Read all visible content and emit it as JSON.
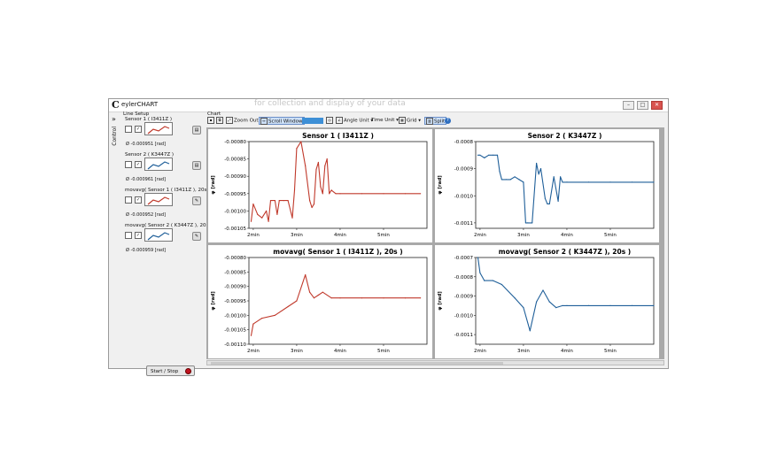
{
  "window": {
    "app_logo": "C",
    "app_title": "eylerCHART",
    "faded_tagline": "for collection and display of your data",
    "minimize": "–",
    "maximize": "□",
    "close": "✕"
  },
  "sidebar": {
    "collapse": "»",
    "tab_label": "Control",
    "line_setup_label": "Line Setup",
    "lines": [
      {
        "name": "Sensor 1 ( I3411Z )",
        "value": "Ø -0.000951 [rad]",
        "color": "#c0392b"
      },
      {
        "name": "Sensor 2 ( K3447Z )",
        "value": "Ø -0.000961 [rad]",
        "color": "#1f5f99"
      },
      {
        "name": "movavg( Sensor 1 ( I3411Z ), 20s )",
        "value": "Ø -0.000952 [rad]",
        "color": "#c0392b"
      },
      {
        "name": "movavg( Sensor 2 ( K3447Z ), 20s )",
        "value": "Ø -0.000959 [rad]",
        "color": "#1f5f99"
      }
    ],
    "start_stop": "Start / Stop"
  },
  "chart_panel": {
    "label": "Chart",
    "toolbar": {
      "zoom_out": "Zoom Out",
      "scroll_window": "Scroll Window",
      "angle_unit": "Angle Unit",
      "time_unit": "Time Unit",
      "grid": "Grid",
      "split": "Split",
      "help": "?"
    }
  },
  "chart_data": [
    {
      "type": "line",
      "title": "Sensor 1 ( I3411Z )",
      "ylabel": "φ [rad]",
      "xticks": [
        "2min",
        "3min",
        "4min",
        "5min"
      ],
      "yticks": [
        "-0.00080",
        "-0.00085",
        "-0.00090",
        "-0.00095",
        "-0.00100",
        "-0.00105"
      ],
      "ylim": [
        -0.00105,
        -0.0008
      ],
      "xlim": [
        1.9,
        6.0
      ],
      "color": "#c0392b",
      "x": [
        1.95,
        2.0,
        2.1,
        2.2,
        2.3,
        2.35,
        2.4,
        2.5,
        2.55,
        2.6,
        2.7,
        2.8,
        2.9,
        2.95,
        3.0,
        3.1,
        3.2,
        3.3,
        3.35,
        3.4,
        3.45,
        3.5,
        3.55,
        3.6,
        3.65,
        3.7,
        3.75,
        3.8,
        3.9,
        4.0,
        4.5,
        5.0,
        5.5,
        5.85
      ],
      "values": [
        -0.00103,
        -0.00098,
        -0.00101,
        -0.00102,
        -0.001,
        -0.00103,
        -0.00097,
        -0.00097,
        -0.00101,
        -0.00097,
        -0.00097,
        -0.00097,
        -0.00102,
        -0.00094,
        -0.00082,
        -0.0008,
        -0.00087,
        -0.00097,
        -0.00099,
        -0.00098,
        -0.00088,
        -0.00086,
        -0.00093,
        -0.00095,
        -0.00087,
        -0.00085,
        -0.00095,
        -0.00094,
        -0.00095,
        -0.00095,
        -0.00095,
        -0.00095,
        -0.00095,
        -0.00095
      ]
    },
    {
      "type": "line",
      "title": "Sensor 2 ( K3447Z )",
      "ylabel": "φ [rad]",
      "xticks": [
        "2min",
        "3min",
        "4min",
        "5min"
      ],
      "yticks": [
        "-0.0008",
        "-0.0009",
        "-0.0010",
        "-0.0011"
      ],
      "ylim": [
        -0.00112,
        -0.0008
      ],
      "xlim": [
        1.9,
        6.0
      ],
      "color": "#1f5f99",
      "x": [
        1.95,
        2.0,
        2.1,
        2.2,
        2.3,
        2.4,
        2.45,
        2.5,
        2.6,
        2.7,
        2.8,
        2.9,
        3.0,
        3.05,
        3.1,
        3.2,
        3.3,
        3.35,
        3.4,
        3.5,
        3.55,
        3.6,
        3.7,
        3.8,
        3.85,
        3.9,
        4.0,
        4.5,
        5.0,
        5.5,
        6.0
      ],
      "values": [
        -0.00085,
        -0.00085,
        -0.00086,
        -0.00085,
        -0.00085,
        -0.00085,
        -0.00091,
        -0.00094,
        -0.00094,
        -0.00094,
        -0.00093,
        -0.00094,
        -0.00095,
        -0.0011,
        -0.0011,
        -0.0011,
        -0.00088,
        -0.00092,
        -0.0009,
        -0.00101,
        -0.00103,
        -0.00103,
        -0.00093,
        -0.00102,
        -0.00093,
        -0.00095,
        -0.00095,
        -0.00095,
        -0.00095,
        -0.00095,
        -0.00095
      ]
    },
    {
      "type": "line",
      "title": "movavg( Sensor 1 ( I3411Z ), 20s )",
      "ylabel": "φ [rad]",
      "xticks": [
        "2min",
        "3min",
        "4min",
        "5min"
      ],
      "yticks": [
        "-0.00080",
        "-0.00085",
        "-0.00090",
        "-0.00095",
        "-0.00100",
        "-0.00105",
        "-0.00110"
      ],
      "ylim": [
        -0.0011,
        -0.0008
      ],
      "xlim": [
        1.9,
        6.0
      ],
      "color": "#c0392b",
      "x": [
        1.95,
        2.0,
        2.2,
        2.5,
        2.8,
        3.0,
        3.2,
        3.3,
        3.4,
        3.5,
        3.6,
        3.8,
        4.0,
        4.5,
        5.0,
        5.5,
        5.85
      ],
      "values": [
        -0.00107,
        -0.00103,
        -0.00101,
        -0.001,
        -0.00097,
        -0.00095,
        -0.00086,
        -0.00092,
        -0.00094,
        -0.00093,
        -0.00092,
        -0.00094,
        -0.00094,
        -0.00094,
        -0.00094,
        -0.00094,
        -0.00094
      ]
    },
    {
      "type": "line",
      "title": "movavg( Sensor 2 ( K3447Z ), 20s )",
      "ylabel": "φ [rad]",
      "xticks": [
        "2min",
        "3min",
        "4min",
        "5min"
      ],
      "yticks": [
        "-0.0007",
        "-0.0008",
        "-0.0009",
        "-0.0010",
        "-0.0011"
      ],
      "ylim": [
        -0.00115,
        -0.0007
      ],
      "xlim": [
        1.9,
        6.0
      ],
      "color": "#1f5f99",
      "x": [
        1.95,
        2.0,
        2.1,
        2.3,
        2.5,
        2.8,
        3.0,
        3.15,
        3.3,
        3.45,
        3.6,
        3.75,
        3.9,
        4.0,
        4.5,
        5.0,
        5.5,
        6.0
      ],
      "values": [
        -0.0007,
        -0.00078,
        -0.00082,
        -0.00082,
        -0.00084,
        -0.00091,
        -0.00096,
        -0.00108,
        -0.00093,
        -0.00087,
        -0.00093,
        -0.00096,
        -0.00095,
        -0.00095,
        -0.00095,
        -0.00095,
        -0.00095,
        -0.00095
      ]
    }
  ]
}
